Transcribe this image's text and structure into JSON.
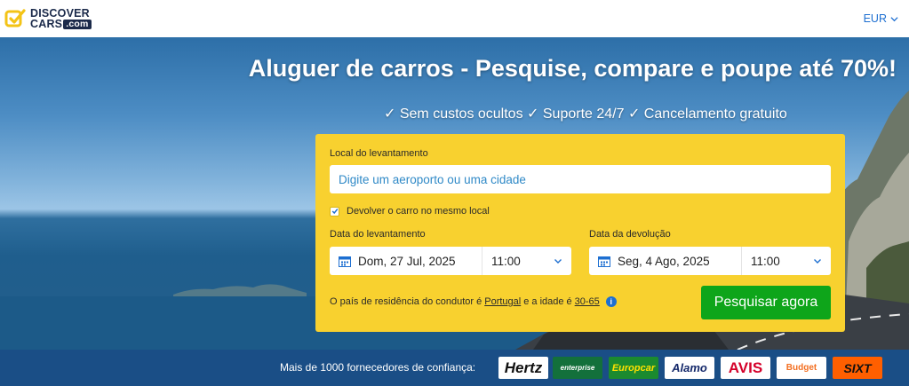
{
  "header": {
    "logo_line1": "DISCOVER",
    "logo_line2": "CARS",
    "logo_com": ".com",
    "currency": "EUR"
  },
  "hero": {
    "title": "Aluguer de carros - Pesquise, compare e poupe até 70%!",
    "subtitle": "✓ Sem custos ocultos ✓ Suporte 24/7 ✓ Cancelamento gratuito"
  },
  "search_form": {
    "pickup_location_label": "Local do levantamento",
    "pickup_location_placeholder": "Digite um aeroporto ou uma cidade",
    "same_location_label": "Devolver o carro no mesmo local",
    "same_location_checked": true,
    "pickup_date_label": "Data do levantamento",
    "pickup_date": "Dom, 27 Jul, 2025",
    "pickup_time": "11:00",
    "return_date_label": "Data da devolução",
    "return_date": "Seg, 4 Ago, 2025",
    "return_time": "11:00",
    "driver_info_prefix": "O país de residência do condutor é",
    "driver_country": "Portugal",
    "driver_info_mid": "e a idade é",
    "driver_age": "30-65",
    "search_button": "Pesquisar agora"
  },
  "suppliers": {
    "label": "Mais de 1000 fornecedores de confiança:",
    "brands": [
      "Hertz",
      "enterprise",
      "Europcar",
      "Alamo",
      "AVIS",
      "Budget",
      "SIXT"
    ]
  },
  "colors": {
    "form_bg": "#f8d12f",
    "search_button_bg": "#0ea51a",
    "suppliers_bg": "#1a4e86",
    "link_blue": "#1d6fd1"
  }
}
